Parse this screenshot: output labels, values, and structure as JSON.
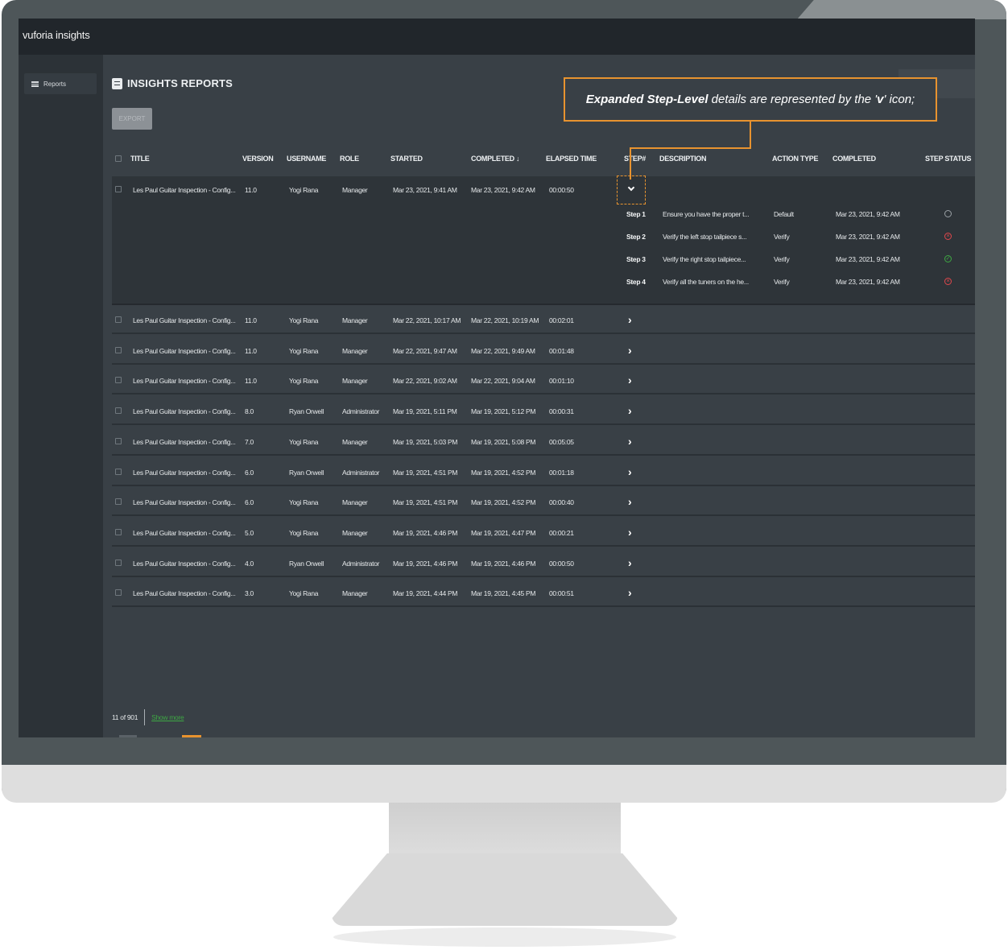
{
  "app": {
    "brand": "vuforia insights"
  },
  "sidebar": {
    "items": [
      {
        "label": "Reports",
        "icon": "list-icon"
      }
    ],
    "help_icon": "?"
  },
  "header": {
    "title": "INSIGHTS REPORTS",
    "export_label": "EXPORT"
  },
  "callout": {
    "bold": "Expanded Step-Level",
    "text": " details are represented by the '",
    "icon_char": "v",
    "end": "' icon;"
  },
  "table": {
    "columns": [
      "TITLE",
      "VERSION",
      "USERNAME",
      "ROLE",
      "STARTED",
      "COMPLETED ↓",
      "ELAPSED TIME",
      "STEP#",
      "DESCRIPTION",
      "ACTION TYPE",
      "COMPLETED",
      "STEP STATUS"
    ],
    "rows": [
      {
        "title": "Les Paul Guitar Inspection - Config...",
        "version": "11.0",
        "username": "Yogi Rana",
        "role": "Manager",
        "started": "Mar 23, 2021, 9:41 AM",
        "completed": "Mar 23, 2021, 9:42 AM",
        "elapsed": "00:00:50"
      },
      {
        "title": "Les Paul Guitar Inspection - Config...",
        "version": "11.0",
        "username": "Yogi Rana",
        "role": "Manager",
        "started": "Mar 22, 2021, 10:17 AM",
        "completed": "Mar 22, 2021, 10:19 AM",
        "elapsed": "00:02:01"
      },
      {
        "title": "Les Paul Guitar Inspection - Config...",
        "version": "11.0",
        "username": "Yogi Rana",
        "role": "Manager",
        "started": "Mar 22, 2021, 9:47 AM",
        "completed": "Mar 22, 2021, 9:49 AM",
        "elapsed": "00:01:48"
      },
      {
        "title": "Les Paul Guitar Inspection - Config...",
        "version": "11.0",
        "username": "Yogi Rana",
        "role": "Manager",
        "started": "Mar 22, 2021, 9:02 AM",
        "completed": "Mar 22, 2021, 9:04 AM",
        "elapsed": "00:01:10"
      },
      {
        "title": "Les Paul Guitar Inspection - Config...",
        "version": "8.0",
        "username": "Ryan Orwell",
        "role": "Administrator",
        "started": "Mar 19, 2021, 5:11 PM",
        "completed": "Mar 19, 2021, 5:12 PM",
        "elapsed": "00:00:31"
      },
      {
        "title": "Les Paul Guitar Inspection - Config...",
        "version": "7.0",
        "username": "Yogi Rana",
        "role": "Manager",
        "started": "Mar 19, 2021, 5:03 PM",
        "completed": "Mar 19, 2021, 5:08 PM",
        "elapsed": "00:05:05"
      },
      {
        "title": "Les Paul Guitar Inspection - Config...",
        "version": "6.0",
        "username": "Ryan Orwell",
        "role": "Administrator",
        "started": "Mar 19, 2021, 4:51 PM",
        "completed": "Mar 19, 2021, 4:52 PM",
        "elapsed": "00:01:18"
      },
      {
        "title": "Les Paul Guitar Inspection - Config...",
        "version": "6.0",
        "username": "Yogi Rana",
        "role": "Manager",
        "started": "Mar 19, 2021, 4:51 PM",
        "completed": "Mar 19, 2021, 4:52 PM",
        "elapsed": "00:00:40"
      },
      {
        "title": "Les Paul Guitar Inspection - Config...",
        "version": "5.0",
        "username": "Yogi Rana",
        "role": "Manager",
        "started": "Mar 19, 2021, 4:46 PM",
        "completed": "Mar 19, 2021, 4:47 PM",
        "elapsed": "00:00:21"
      },
      {
        "title": "Les Paul Guitar Inspection - Config...",
        "version": "4.0",
        "username": "Ryan Orwell",
        "role": "Administrator",
        "started": "Mar 19, 2021, 4:46 PM",
        "completed": "Mar 19, 2021, 4:46 PM",
        "elapsed": "00:00:50"
      },
      {
        "title": "Les Paul Guitar Inspection - Config...",
        "version": "3.0",
        "username": "Yogi Rana",
        "role": "Manager",
        "started": "Mar 19, 2021, 4:44 PM",
        "completed": "Mar 19, 2021, 4:45 PM",
        "elapsed": "00:00:51"
      }
    ],
    "steps": [
      {
        "step": "Step 1",
        "description": "Ensure you have the proper t...",
        "action": "Default",
        "completed": "Mar 23, 2021, 9:42 AM",
        "status": "default",
        "status_color": "#9aa0a5"
      },
      {
        "step": "Step 2",
        "description": "Verify the left stop tailpiece s...",
        "action": "Verify",
        "completed": "Mar 23, 2021, 9:42 AM",
        "status": "fail",
        "status_color": "#e0474c"
      },
      {
        "step": "Step 3",
        "description": "Verify the right stop tailpiece...",
        "action": "Verify",
        "completed": "Mar 23, 2021, 9:42 AM",
        "status": "pass",
        "status_color": "#3ea843"
      },
      {
        "step": "Step 4",
        "description": "Verify all the tuners on the he...",
        "action": "Verify",
        "completed": "Mar 23, 2021, 9:42 AM",
        "status": "fail",
        "status_color": "#e0474c"
      }
    ]
  },
  "footer": {
    "count": "11 of 901",
    "show_more": "Show more"
  },
  "colors": {
    "accent": "#e8932f",
    "link": "#3ea843",
    "background": "#394046",
    "topbar": "#21262b"
  }
}
